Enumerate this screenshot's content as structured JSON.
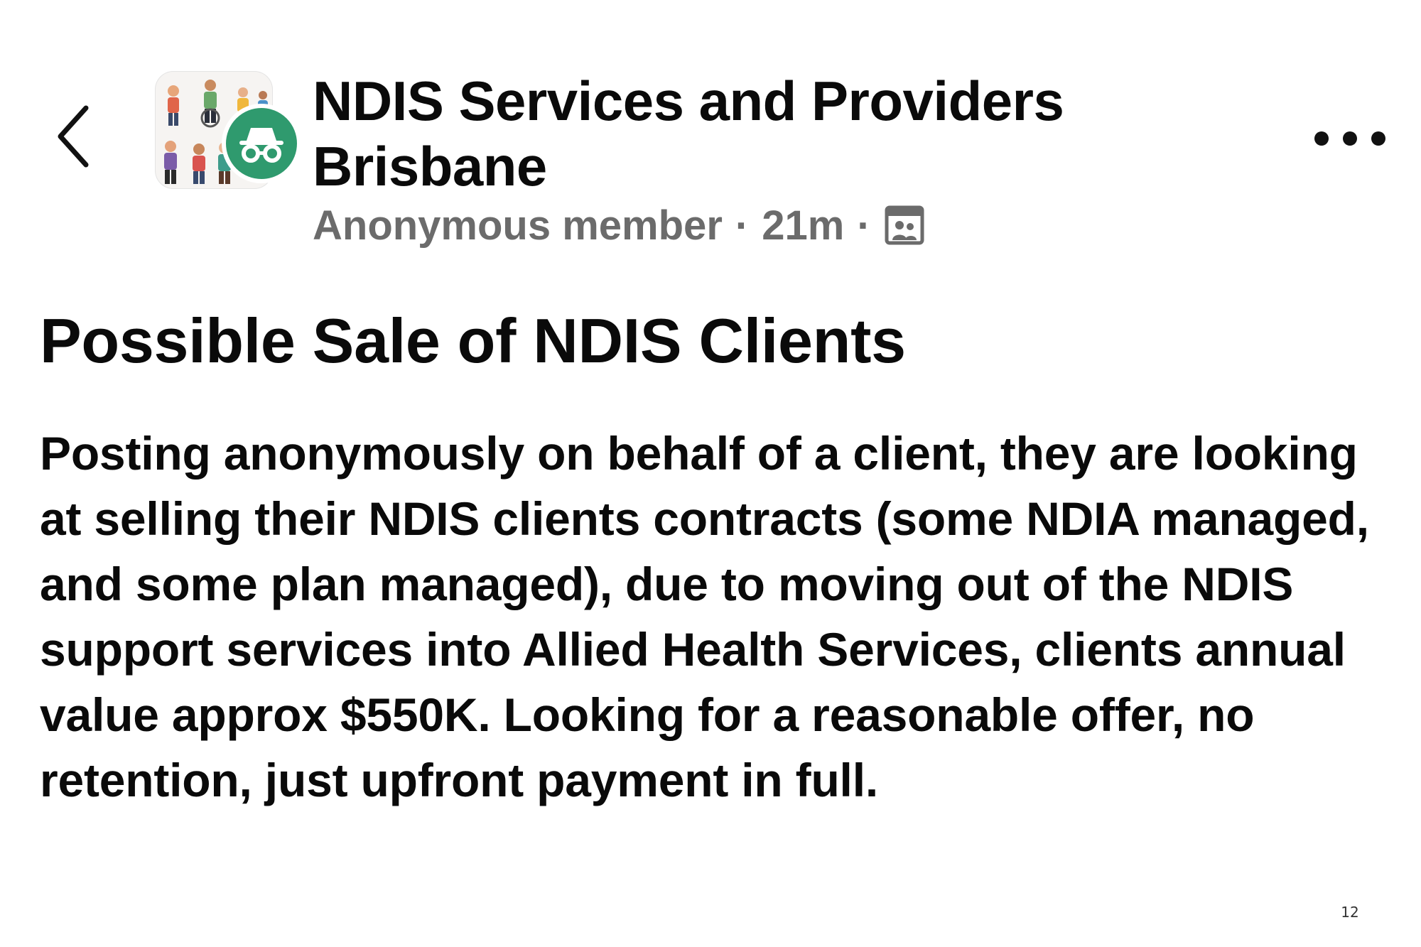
{
  "header": {
    "back_icon": "chevron-left-icon",
    "group_name": "NDIS Services and Providers Brisbane",
    "author": "Anonymous member",
    "separator": "·",
    "timestamp": "21m",
    "privacy_icon": "group-members-icon",
    "more_icon": "more-horizontal-icon",
    "anon_badge_icon": "incognito-icon",
    "anon_badge_color": "#2f9a6e"
  },
  "post": {
    "title": "Possible Sale of NDIS Clients",
    "body": "Posting anonymously on behalf of a client, they are looking at selling their NDIS clients contracts (some NDIA managed, and some plan managed), due to moving out of the NDIS support services into Allied Health Services, clients annual value approx $550K. Looking for a reasonable offer, no retention, just upfront payment in full."
  },
  "footer": {
    "page_number": "12"
  }
}
